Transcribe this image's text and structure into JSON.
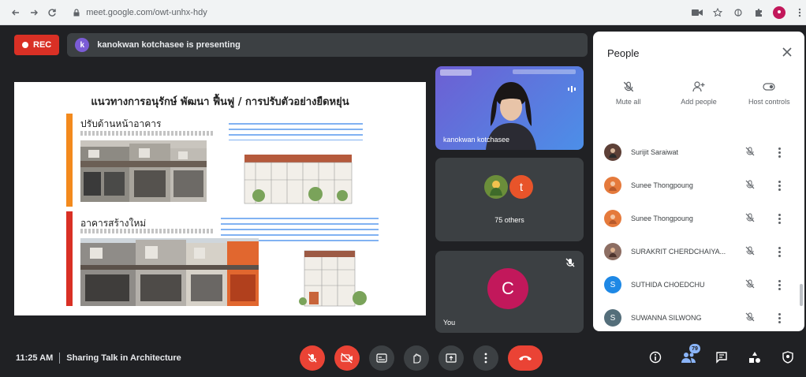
{
  "browser": {
    "url": "meet.google.com/owt-unhx-hdy"
  },
  "top": {
    "rec_label": "REC",
    "presenter_initial": "k",
    "presenting_text": "kanokwan kotchasee is presenting"
  },
  "slide": {
    "title": "แนวทางการอนุรักษ์ พัฒนา ฟื้นฟู / การปรับตัวอย่างยืดหยุ่น",
    "section1_heading": "ปรับด้านหน้าอาคาร",
    "section2_heading": "อาคารสร้างใหม่"
  },
  "tiles": {
    "presenter_name": "kanokwan kotchasee",
    "others_initial": "t",
    "others_label": "75 others",
    "you_initial": "C",
    "you_label": "You"
  },
  "bottom": {
    "time": "11:25 AM",
    "meeting_title": "Sharing Talk in Architecture",
    "participants_count": "79"
  },
  "people": {
    "title": "People",
    "actions": [
      {
        "label": "Mute all",
        "icon": "mic-off-icon"
      },
      {
        "label": "Add people",
        "icon": "add-person-icon"
      },
      {
        "label": "Host controls",
        "icon": "host-controls-icon"
      }
    ],
    "list": [
      {
        "name": "Surijit Saraiwat",
        "initial": "",
        "color": "#5d4037"
      },
      {
        "name": "Sunee Thongpoung",
        "initial": "",
        "color": "#e57a3c"
      },
      {
        "name": "Sunee Thongpoung",
        "initial": "",
        "color": "#e57a3c"
      },
      {
        "name": "SURAKRIT CHERDCHAIYA...",
        "initial": "",
        "color": "#8d6e63"
      },
      {
        "name": "SUTHIDA CHOEDCHU",
        "initial": "S",
        "color": "#1e88e5"
      },
      {
        "name": "SUWANNA SILWONG",
        "initial": "S",
        "color": "#546e7a"
      }
    ]
  },
  "colors": {
    "meet_bg": "#202124",
    "tile_bg": "#3c4043",
    "danger_red": "#ea4335",
    "you_avatar": "#c2185b",
    "others_avatar": "#e8542a"
  }
}
